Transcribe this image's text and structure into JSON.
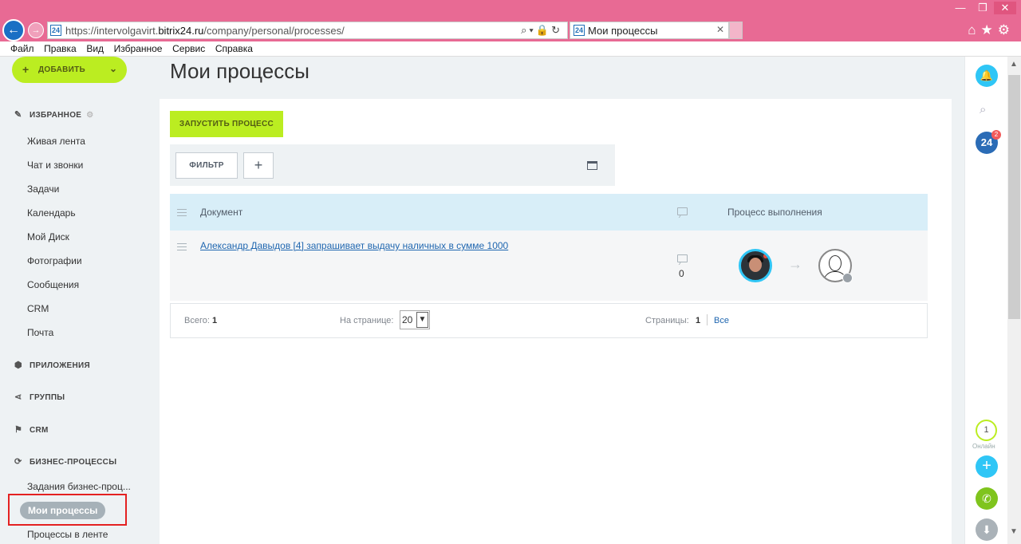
{
  "browser": {
    "url_prefix": "https://intervolgavirt.",
    "url_domain": "bitrix24.ru",
    "url_path": "/company/personal/processes/",
    "tab_title": "Мои процессы",
    "favicon": "24",
    "menu": [
      "Файл",
      "Правка",
      "Вид",
      "Избранное",
      "Сервис",
      "Справка"
    ]
  },
  "sidebar": {
    "add_label": "ДОБАВИТЬ",
    "favorites_label": "ИЗБРАННОЕ",
    "favorites": [
      "Живая лента",
      "Чат и звонки",
      "Задачи",
      "Календарь",
      "Мой Диск",
      "Фотографии",
      "Сообщения",
      "CRM",
      "Почта"
    ],
    "apps_label": "ПРИЛОЖЕНИЯ",
    "groups_label": "ГРУППЫ",
    "crm_label": "CRM",
    "bp_label": "БИЗНЕС-ПРОЦЕССЫ",
    "bp_items": [
      "Задания бизнес-проц...",
      "Мои процессы",
      "Процессы в ленте"
    ]
  },
  "main": {
    "title": "Мои процессы",
    "start_label": "ЗАПУСТИТЬ ПРОЦЕСС",
    "filter_label": "ФИЛЬТР",
    "plus_label": "+",
    "col_document": "Документ",
    "col_process": "Процесс выполнения",
    "row": {
      "document": "Александр Давыдов [4] запрашивает выдачу наличных в сумме 1000",
      "comments": "0"
    },
    "footer": {
      "total_label": "Всего:",
      "total_value": "1",
      "per_page_label": "На странице:",
      "per_page_value": "20",
      "pages_label": "Страницы:",
      "current_page": "1",
      "all_label": "Все"
    }
  },
  "right_panel": {
    "notifications_badge": "2",
    "logo": "24",
    "online_count": "1",
    "online_label": "Онлайн"
  },
  "colors": {
    "accent_green": "#bbed21",
    "header_blue": "#d8eef8",
    "link_blue": "#2067b0",
    "chrome_pink": "#e86a94"
  }
}
